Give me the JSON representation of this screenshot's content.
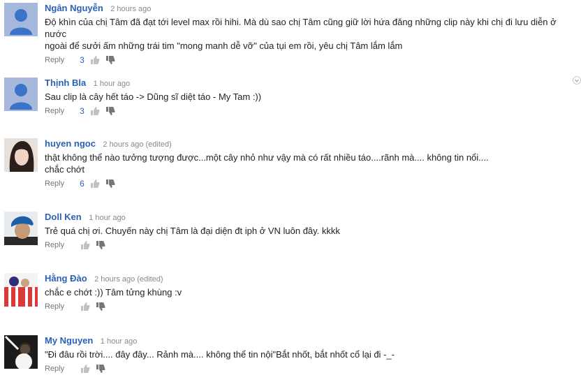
{
  "comments": [
    {
      "author": "Ngân Nguyễn",
      "time": "2 hours ago",
      "edited": "",
      "text_lines": [
        "Độ khìn của chị Tâm đã đạt tới level max rồi hihi. Mà dù sao chị Tâm cũng giữ lời hứa đăng những clip này khi chị đi lưu diễn ở nước",
        "ngoài để sưởi ấm những trái tim \"mong manh dễ vỡ\" của tụi em rồi, yêu chị Tâm lắm lắm"
      ],
      "reply": "Reply",
      "likes": "3",
      "avatar": "default-avatar"
    },
    {
      "author": "Thịnh Bla",
      "time": "1 hour ago",
      "edited": "",
      "text_lines": [
        "Sau clip là cây hết táo -> Dũng sĩ diệt táo - My Tam :))"
      ],
      "reply": "Reply",
      "likes": "3",
      "avatar": "default-avatar"
    },
    {
      "author": "huyen ngoc",
      "time": "2 hours ago",
      "edited": "(edited)",
      "text_lines": [
        "thật không thể nào tưởng tượng được...một cây nhỏ như vậy mà có rất nhiều táo....rãnh mà.... không tin nổi....",
        "chắc chớt"
      ],
      "reply": "Reply",
      "likes": "6",
      "avatar": "photo-avatar"
    },
    {
      "author": "Doll Ken",
      "time": "1 hour ago",
      "edited": "",
      "text_lines": [
        "Trẻ quá chị ơi. Chuyến này chị Tâm là đại diện đt iph ở VN luôn đây. kkkk"
      ],
      "reply": "Reply",
      "likes": "",
      "avatar": "photo-avatar"
    },
    {
      "author": "Hằng Đào",
      "time": "2 hours ago",
      "edited": "(edited)",
      "text_lines": [
        "chắc e chớt :)) Tâm tửng khùng :v"
      ],
      "reply": "Reply",
      "likes": "",
      "avatar": "photo-avatar"
    },
    {
      "author": "My Nguyen",
      "time": "1 hour ago",
      "edited": "",
      "text_lines": [
        "\"Đi đâu rồi trời.... đây đây... Rảnh mà.... không thể tin nội\"Bắt nhốt, bắt nhốt cổ lại đi -_-"
      ],
      "reply": "Reply",
      "likes": "",
      "avatar": "photo-avatar"
    }
  ],
  "colors": {
    "author": "#2a61b5",
    "meta": "#888888",
    "text": "#222222",
    "default_avatar": "#a6b9dc"
  }
}
